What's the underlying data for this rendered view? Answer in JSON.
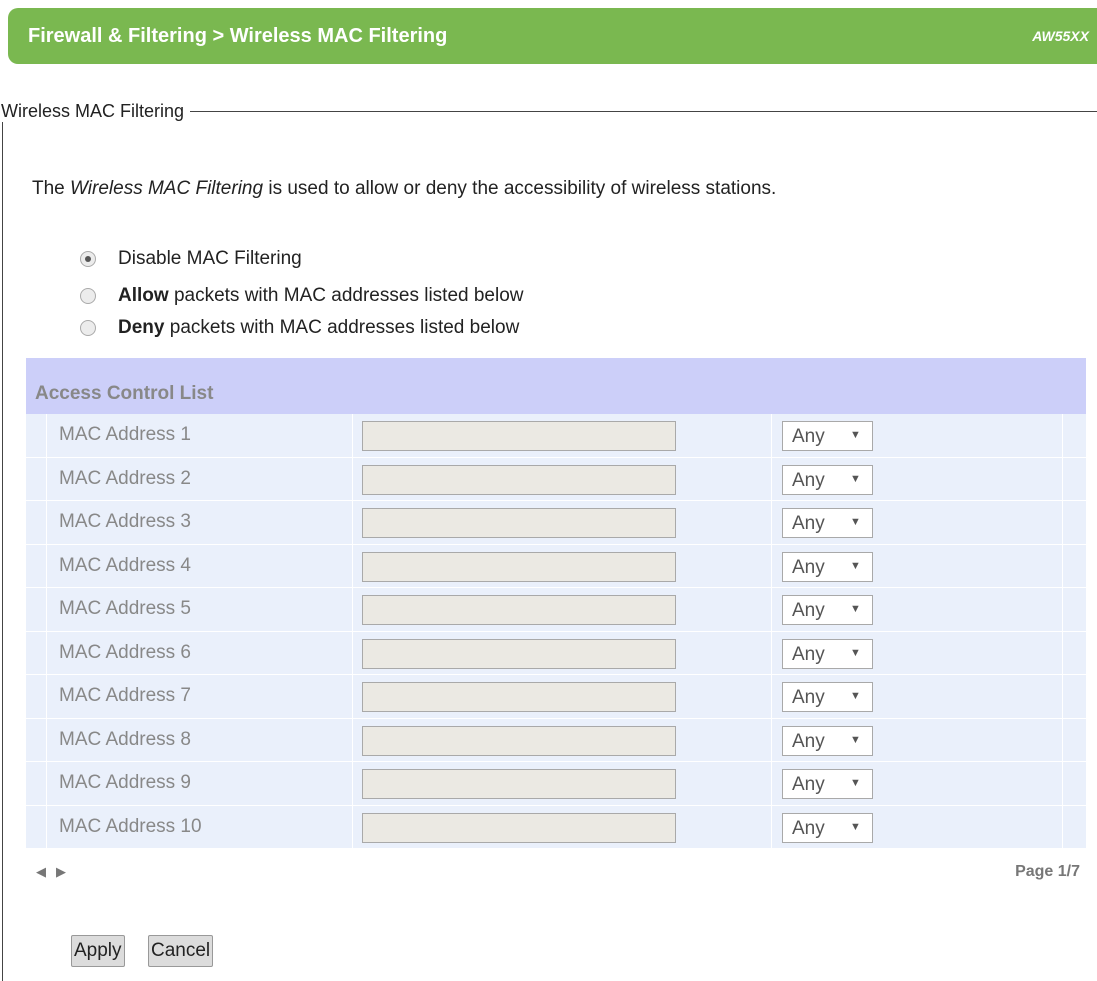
{
  "header": {
    "title": "Firewall & Filtering > Wireless MAC Filtering",
    "model": "AW55XX",
    "color": "#7ab850"
  },
  "section": {
    "legend": "Wireless MAC Filtering",
    "description_prefix": "The ",
    "description_em": "Wireless MAC Filtering",
    "description_suffix": " is used to allow or deny the accessibility of wireless stations."
  },
  "filter_mode": {
    "selected": "disable",
    "options": [
      {
        "id": "disable",
        "bold": "",
        "text": "Disable MAC Filtering"
      },
      {
        "id": "allow",
        "bold": "Allow",
        "text": " packets with MAC addresses listed below"
      },
      {
        "id": "deny",
        "bold": "Deny",
        "text": " packets with MAC addresses listed below"
      }
    ]
  },
  "acl": {
    "title": "Access Control List",
    "header_color": "#cccff9",
    "row_color": "#eaf0fb",
    "rows": [
      {
        "label": "MAC Address 1",
        "value": "",
        "select": "Any"
      },
      {
        "label": "MAC Address 2",
        "value": "",
        "select": "Any"
      },
      {
        "label": "MAC Address 3",
        "value": "",
        "select": "Any"
      },
      {
        "label": "MAC Address 4",
        "value": "",
        "select": "Any"
      },
      {
        "label": "MAC Address 5",
        "value": "",
        "select": "Any"
      },
      {
        "label": "MAC Address 6",
        "value": "",
        "select": "Any"
      },
      {
        "label": "MAC Address 7",
        "value": "",
        "select": "Any"
      },
      {
        "label": "MAC Address 8",
        "value": "",
        "select": "Any"
      },
      {
        "label": "MAC Address 9",
        "value": "",
        "select": "Any"
      },
      {
        "label": "MAC Address 10",
        "value": "",
        "select": "Any"
      }
    ]
  },
  "pager": {
    "prev_icon": "◀",
    "next_icon": "▶",
    "page_info": "Page 1/7"
  },
  "buttons": {
    "apply": "Apply",
    "cancel": "Cancel"
  }
}
